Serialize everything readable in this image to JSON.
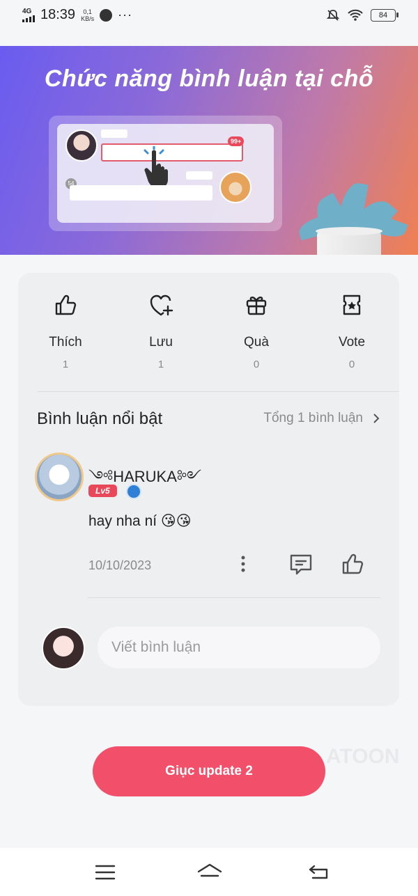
{
  "status_bar": {
    "network": "4G",
    "time": "18:39",
    "speed_value": "0,1",
    "speed_unit": "KB/s",
    "dots": "···",
    "battery": "84"
  },
  "banner": {
    "title": "Chức năng bình luận tại chỗ",
    "mock_badge": "99+",
    "mock_count": "54"
  },
  "stats": [
    {
      "label": "Thích",
      "count": "1",
      "icon": "thumbs-up-icon"
    },
    {
      "label": "Lưu",
      "count": "1",
      "icon": "heart-plus-icon"
    },
    {
      "label": "Quà",
      "count": "0",
      "icon": "gift-icon"
    },
    {
      "label": "Vote",
      "count": "0",
      "icon": "vote-ticket-icon"
    }
  ],
  "comments_section": {
    "title": "Bình luận nổi bật",
    "total": "Tổng 1 bình luận"
  },
  "comment": {
    "username": "HARUKA",
    "level": "Lv5",
    "text": "hay nha ní 😘😘",
    "date": "10/10/2023"
  },
  "composer": {
    "placeholder": "Viết bình luận"
  },
  "cta": {
    "label": "Giục update 2"
  },
  "watermark": "ATOON",
  "colors": {
    "accent": "#f2506a",
    "card_bg": "#eeeff1",
    "page_bg": "#f5f6f8"
  }
}
